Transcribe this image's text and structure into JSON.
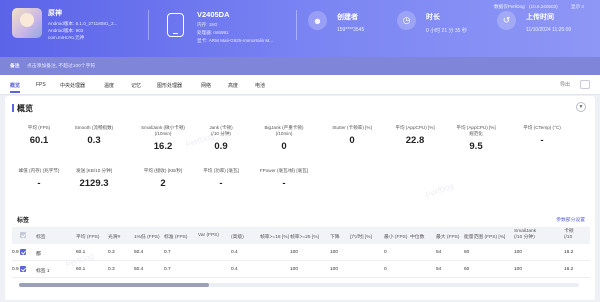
{
  "app": {
    "name": "原神",
    "line1": "Android版本: 5.1.0_27118081_2...",
    "line2": "Android版本: 903",
    "line3": "com.miHoYo.元神"
  },
  "device": {
    "name": "V2405DA",
    "line1": "内存: 15G",
    "line2": "处理器: mt6991",
    "line3": "显卡: ARM Mali-G925-Immortalis M..."
  },
  "stats": {
    "creator_title": "创建者",
    "creator_value": "159****3545",
    "duration_title": "时长",
    "duration_value": "0 小时 21 分 35 秒",
    "upload_title": "上传时间",
    "upload_value": "11/10/2024 11:25:09"
  },
  "top_links": [
    "数据仅PerfDog",
    "(10.6.240503)",
    "显示 ≡"
  ],
  "note": {
    "label": "备注",
    "text": "点击添加备注, 不超过100个字符"
  },
  "tabs": [
    "概览",
    "FPS",
    "中央处理器",
    "温度",
    "记忆",
    "图形处理器",
    "网络",
    "高度",
    "电池"
  ],
  "tabs_right": "导出",
  "overview": {
    "title": "概览",
    "metrics_row1": [
      {
        "label": "平均 (FPS)",
        "value": "60.1"
      },
      {
        "label": "Smooth (流畅指数)",
        "value": "0.3"
      },
      {
        "label": "SmallJank (微小卡顿)\n(/10min)",
        "value": "16.2"
      },
      {
        "label": "Jank (卡顿)\n(/10 分钟)",
        "value": "0.9"
      },
      {
        "label": "BigJank (严重卡顿)\n(/10min)",
        "value": "0"
      },
      {
        "label": "Stutter (卡顿率) [%]",
        "value": "0"
      },
      {
        "label": "平均 (AppCPU) [%]",
        "value": "22.8"
      },
      {
        "label": "平均 (AppCPU) [%]\n规范化",
        "value": "9.5"
      },
      {
        "label": "平均 (CTemp) (°C)",
        "value": "-"
      }
    ],
    "metrics_row2": [
      {
        "label": "峰值 (内存) (兆字节)",
        "value": "-"
      },
      {
        "label": "发送 [KB/10 分钟]",
        "value": "2129.3"
      },
      {
        "label": "平均 (接收) [KB/秒]",
        "value": "2"
      },
      {
        "label": "平均 (功率) [毫瓦]",
        "value": "-"
      },
      {
        "label": "FPower (毫瓦/帧) [毫瓦]",
        "value": "-"
      }
    ]
  },
  "table": {
    "title": "标签",
    "link": "参数部分设置",
    "headers": [
      "标签",
      "平均 (FPS)",
      "光滑#",
      "1%低 (FPS)",
      "标准 (FPS)",
      "Var (FPS)",
      "(高级)",
      "帧率>=18 [%]",
      "帧率>=25 [%]",
      "下降",
      "[六/时] [%]",
      "最小 (FPS)",
      "中位数",
      "最大 (FPS)",
      "能量范围 (FPS) [%]",
      "SmallJank\n(/10 分钟)",
      "卡顿\n(/10"
    ],
    "rows": [
      {
        "label": "都",
        "values": [
          "60.1",
          "0.3",
          "50.4",
          "0.7",
          "",
          "0.4",
          "",
          "100",
          "100",
          "",
          "0",
          "",
          "54",
          "60",
          "100",
          "16.2",
          "0.9"
        ]
      },
      {
        "label": "标签 1",
        "values": [
          "60.1",
          "0.3",
          "50.4",
          "0.7",
          "",
          "0.4",
          "",
          "100",
          "100",
          "",
          "0",
          "",
          "54",
          "60",
          "100",
          "16.2",
          "0.9"
        ]
      }
    ]
  },
  "watermark": "PerfDog",
  "colors": {
    "accent": "#5d63df",
    "header_start": "#5b63e8",
    "header_end": "#8e97f5"
  }
}
